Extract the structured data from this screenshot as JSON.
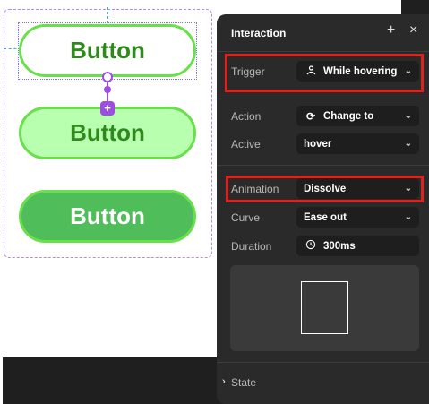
{
  "canvas": {
    "buttons": [
      {
        "label": "Button",
        "state": "default"
      },
      {
        "label": "Button",
        "state": "hover"
      },
      {
        "label": "Button",
        "state": "pressed"
      }
    ],
    "connector_plus": "+"
  },
  "panel": {
    "title": "Interaction",
    "add_icon": "+",
    "close_icon": "×",
    "trigger": {
      "label": "Trigger",
      "value": "While hovering",
      "icon": "hover-icon"
    },
    "action": {
      "label": "Action",
      "value": "Change to",
      "icon": "refresh-icon"
    },
    "active": {
      "label": "Active",
      "value": "hover"
    },
    "animation": {
      "label": "Animation",
      "value": "Dissolve"
    },
    "curve": {
      "label": "Curve",
      "value": "Ease out"
    },
    "duration": {
      "label": "Duration",
      "value": "300ms",
      "icon": "timer-icon"
    },
    "state": {
      "label": "State"
    }
  },
  "colors": {
    "highlight": "#e3211c",
    "button_border": "#69e04b",
    "button_text": "#2f8a1c",
    "connector": "#9b4ee0",
    "panel_bg": "#2a2a2a"
  }
}
